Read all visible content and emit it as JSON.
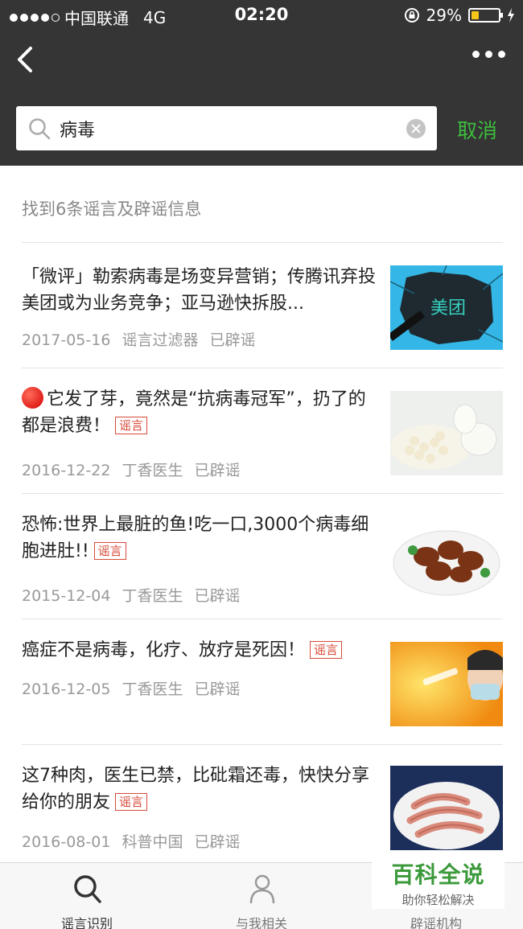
{
  "status_bar": {
    "carrier": "中国联通",
    "network": "4G",
    "time": "02:20",
    "battery": "29%",
    "battery_level": 0.29
  },
  "search": {
    "query": "病毒",
    "cancel_label": "取消"
  },
  "results": {
    "count_text": "找到6条谣言及辟谣信息",
    "items": [
      {
        "title": "「微评」勒索病毒是场变异营销；传腾讯弃投美团或为业务竞争；亚马逊快拆股...",
        "tag": "",
        "date": "2017-05-16",
        "source": "谣言过滤器",
        "status": "已辟谣",
        "thumb_text": "美团"
      },
      {
        "title": "它发了芽，竟然是“抗病毒冠军”，扔了的都是浪费！",
        "tag": "谣言",
        "date": "2016-12-22",
        "source": "丁香医生",
        "status": "已辟谣"
      },
      {
        "title": "恐怖:世界上最脏的鱼!吃一口,3000个病毒细胞进肚!!",
        "tag": "谣言",
        "date": "2015-12-04",
        "source": "丁香医生",
        "status": "已辟谣"
      },
      {
        "title": "癌症不是病毒，化疗、放疗是死因！",
        "tag": "谣言",
        "date": "2016-12-05",
        "source": "丁香医生",
        "status": "已辟谣"
      },
      {
        "title": "这7种肉，医生已禁，比砒霜还毒，快快分享给你的朋友",
        "tag": "谣言",
        "date": "2016-08-01",
        "source": "科普中国",
        "status": "已辟谣"
      }
    ]
  },
  "tabs": [
    {
      "label": "谣言识别",
      "icon": "search-icon",
      "active": true
    },
    {
      "label": "与我相关",
      "icon": "person-icon",
      "active": false
    },
    {
      "label": "辟谣机构",
      "icon": "",
      "active": false
    }
  ],
  "watermark": {
    "title": "百科全说",
    "subtitle": "助你轻松解决"
  },
  "colors": {
    "header_bg": "#353535",
    "accent_green": "#3dbd3d",
    "rumor_tag": "#d84b3a"
  }
}
